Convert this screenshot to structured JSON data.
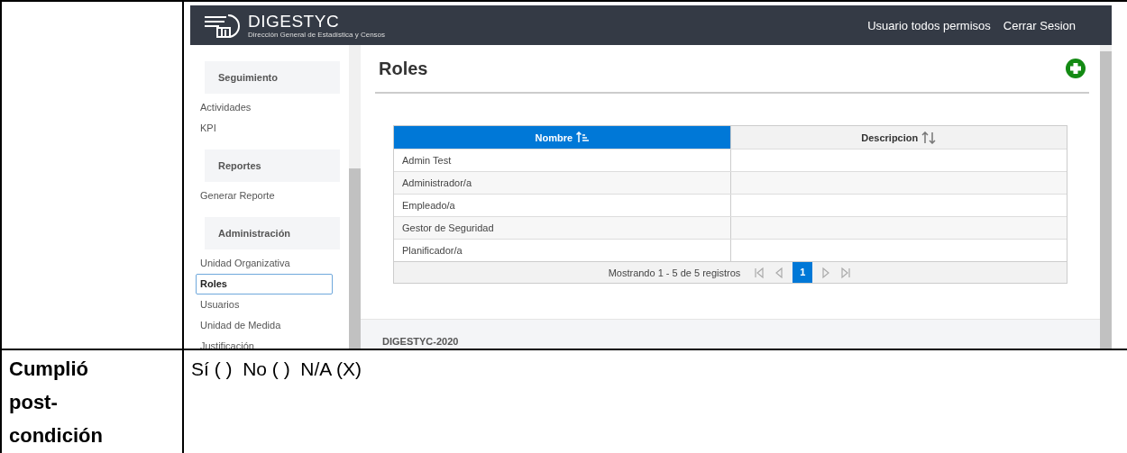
{
  "header": {
    "logo_text": "DIGESTYC",
    "logo_subtitle": "Dirección General de Estadística y Censos",
    "user": "Usuario todos permisos",
    "logout": "Cerrar Sesion"
  },
  "sidebar": {
    "groups": [
      {
        "heading": "Seguimiento",
        "items": [
          {
            "label": "Actividades",
            "selected": false
          },
          {
            "label": "KPI",
            "selected": false
          }
        ]
      },
      {
        "heading": "Reportes",
        "items": [
          {
            "label": "Generar Reporte",
            "selected": false
          }
        ]
      },
      {
        "heading": "Administración",
        "items": [
          {
            "label": "Unidad Organizativa",
            "selected": false
          },
          {
            "label": "Roles",
            "selected": true
          },
          {
            "label": "Usuarios",
            "selected": false
          },
          {
            "label": "Unidad de Medida",
            "selected": false
          },
          {
            "label": "Justificación",
            "selected": false
          }
        ]
      }
    ]
  },
  "page": {
    "title": "Roles"
  },
  "table": {
    "columns": [
      {
        "label": "Nombre",
        "sorted": true
      },
      {
        "label": "Descripcion",
        "sorted": false
      }
    ],
    "rows": [
      {
        "name": "Admin Test"
      },
      {
        "name": "Administrador/a"
      },
      {
        "name": "Empleado/a"
      },
      {
        "name": "Gestor de Seguridad"
      },
      {
        "name": "Planificador/a"
      }
    ]
  },
  "pagination": {
    "summary": "Mostrando 1 - 5 de 5 registros",
    "pages": [
      {
        "label": "1",
        "selected": true
      }
    ]
  },
  "footer": "DIGESTYC-2020",
  "checklist": {
    "label": "Cumplió post-condición",
    "answer": "Sí ( )  No ( )  N/A (X)"
  }
}
